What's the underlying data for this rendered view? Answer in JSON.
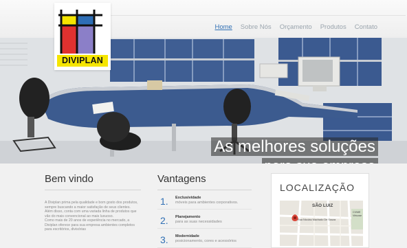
{
  "brand": {
    "name": "DIVIPLAN"
  },
  "nav": {
    "items": [
      {
        "label": "Home",
        "active": true
      },
      {
        "label": "Sobre Nós",
        "active": false
      },
      {
        "label": "Orçamento",
        "active": false
      },
      {
        "label": "Produtos",
        "active": false
      },
      {
        "label": "Contato",
        "active": false
      }
    ]
  },
  "hero": {
    "line1": "As melhores soluções",
    "line2": "para sua empresa"
  },
  "welcome": {
    "title": "Bem vindo",
    "paragraphs": [
      "A Diviplan prima pela qualidade e bom gosto dos produtos, sempre buscando a maior satisfação de seus clientes.",
      "Além disso, conta com uma variada linha de produtos que vão do mais convencional ao mais luxuoso.",
      "Como mais de 20 anos de experiência no mercado, a Diviplan oferece para sua empresa ambientes completos para escritórios, divisórias"
    ]
  },
  "advantages": {
    "title": "Vantagens",
    "items": [
      {
        "number": "1.",
        "title": "Exclusividade",
        "desc": "móveis para ambientes corporativos."
      },
      {
        "number": "2.",
        "title": "Planejamento",
        "desc": "para as suas necessidades"
      },
      {
        "number": "3.",
        "title": "Modernidade",
        "desc": "posicionamento, cores e acessórios"
      }
    ]
  },
  "location": {
    "title": "LOCALIZAÇÃO",
    "map": {
      "district": "SÃO LUIZ",
      "street": "Rua Nicolau Machado De Souza",
      "poi": "CIVME\nVirtuose"
    }
  },
  "colors": {
    "accent": "#2f6fb4",
    "logo_red": "#e0312f",
    "logo_blue": "#2e6eb5",
    "logo_yellow": "#f5e500",
    "logo_purple": "#8b7fc8",
    "logo_lilac": "#9a90d4"
  }
}
